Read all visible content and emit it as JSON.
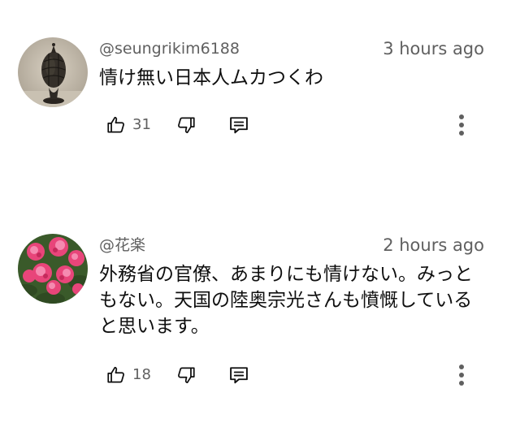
{
  "comments": [
    {
      "author": "@seungrikim6188",
      "time": "3 hours ago",
      "text": "情け無い日本人ムカつくわ",
      "likes": "31",
      "avatar": "dark-sculpture-avatar"
    },
    {
      "author": "@花楽",
      "time": "2 hours ago",
      "text": "外務省の官僚、あまりにも情けない。みっともない。天国の陸奥宗光さんも憤慨していると思います。",
      "likes": "18",
      "avatar": "pink-flowers-avatar"
    }
  ],
  "icons": {
    "like": "thumbs-up-icon",
    "dislike": "thumbs-down-icon",
    "reply": "reply-comment-icon",
    "more": "more-vertical-icon"
  },
  "colors": {
    "text": "#0f0f0f",
    "secondary": "#606060",
    "background": "#ffffff"
  }
}
